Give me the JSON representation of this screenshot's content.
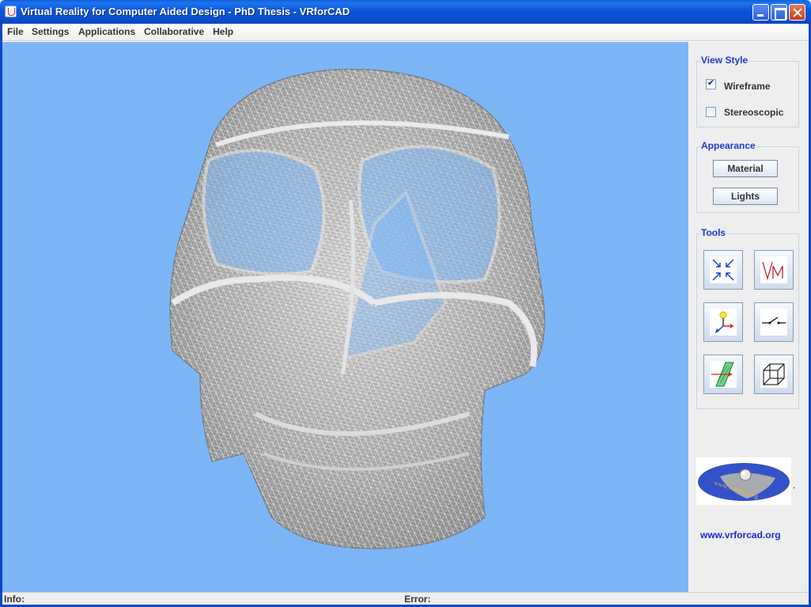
{
  "window": {
    "title": "Virtual Reality for Computer Aided Design - PhD Thesis  - VRforCAD",
    "buttons": [
      "minimize",
      "maximize",
      "close"
    ]
  },
  "menu": {
    "items": [
      {
        "label": "File"
      },
      {
        "label": "Settings"
      },
      {
        "label": "Applications"
      },
      {
        "label": "Collaborative"
      },
      {
        "label": "Help"
      }
    ]
  },
  "viewport": {
    "background": "#7cb6f6",
    "model": "skull-wireframe"
  },
  "panel": {
    "view_style": {
      "title": "View Style",
      "wireframe": {
        "label": "Wireframe",
        "checked": true
      },
      "stereoscopic": {
        "label": "Stereoscopic",
        "checked": false
      }
    },
    "appearance": {
      "title": "Appearance",
      "material_label": "Material",
      "lights_label": "Lights"
    },
    "tools": {
      "title": "Tools",
      "items": [
        {
          "icon": "zoom-fit-icon"
        },
        {
          "icon": "vm-icon",
          "text": "VM"
        },
        {
          "icon": "axes-icon"
        },
        {
          "icon": "switch-icon"
        },
        {
          "icon": "section-plane-icon"
        },
        {
          "icon": "bounding-box-icon"
        }
      ]
    },
    "logo": {
      "text": "www.vrforcad.org"
    },
    "logo_trailing": ".",
    "site_link": "www.vrforcad.org"
  },
  "status": {
    "info_label": "Info:",
    "error_label": "Error:"
  },
  "colors": {
    "titlebar": "#0a55da",
    "group_title": "#1c3ad0",
    "link": "#1a2bd0"
  }
}
